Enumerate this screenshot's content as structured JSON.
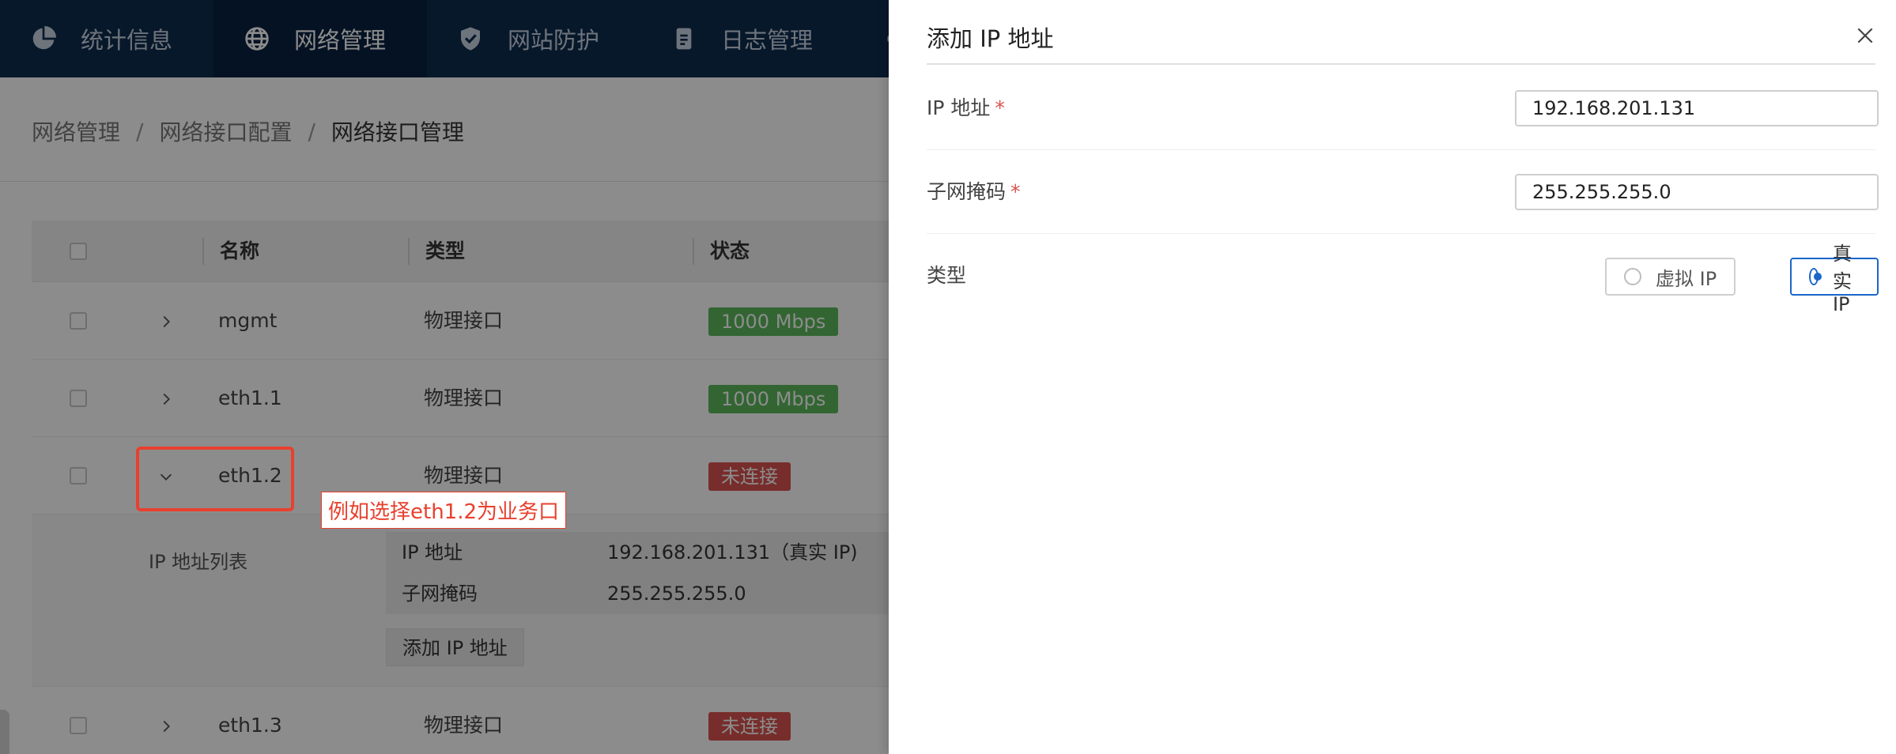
{
  "nav": {
    "items": [
      {
        "label": "统计信息",
        "icon": "pie-chart-icon"
      },
      {
        "label": "网络管理",
        "icon": "globe-icon"
      },
      {
        "label": "网站防护",
        "icon": "shield-icon"
      },
      {
        "label": "日志管理",
        "icon": "document-icon"
      }
    ],
    "colors": {
      "background": "#0f2c4f",
      "active": "#0a2240"
    }
  },
  "breadcrumb": {
    "items": [
      "网络管理",
      "网络接口配置",
      "网络接口管理"
    ],
    "separator": "/"
  },
  "table": {
    "headers": {
      "name": "名称",
      "type": "类型",
      "status": "状态"
    },
    "rows": [
      {
        "name": "mgmt",
        "type": "物理接口",
        "status": "1000 Mbps",
        "status_color": "#5cb85c"
      },
      {
        "name": "eth1.1",
        "type": "物理接口",
        "status": "1000 Mbps",
        "status_color": "#5cb85c"
      },
      {
        "name": "eth1.2",
        "type": "物理接口",
        "status": "未连接",
        "status_color": "#d9534f"
      },
      {
        "name": "eth1.3",
        "type": "物理接口",
        "status": "未连接",
        "status_color": "#d9534f"
      }
    ],
    "expanded": {
      "label": "IP 地址列表",
      "ip_key": "IP 地址",
      "ip_value": "192.168.201.131（真实 IP)",
      "mask_key": "子网掩码",
      "mask_value": "255.255.255.0",
      "add_button": "添加 IP 地址"
    }
  },
  "annotation": {
    "text": "例如选择eth1.2为业务口",
    "color": "#e8402e"
  },
  "drawer": {
    "title": "添加 IP 地址",
    "fields": {
      "ip": {
        "label": "IP 地址",
        "required_mark": "*",
        "value": "192.168.201.131"
      },
      "mask": {
        "label": "子网掩码",
        "required_mark": "*",
        "value": "255.255.255.0"
      },
      "type": {
        "label": "类型",
        "options": [
          {
            "label": "虚拟 IP",
            "selected": false
          },
          {
            "label": "真实 IP",
            "selected": true
          }
        ]
      }
    },
    "accent_color": "#1b66c9"
  }
}
